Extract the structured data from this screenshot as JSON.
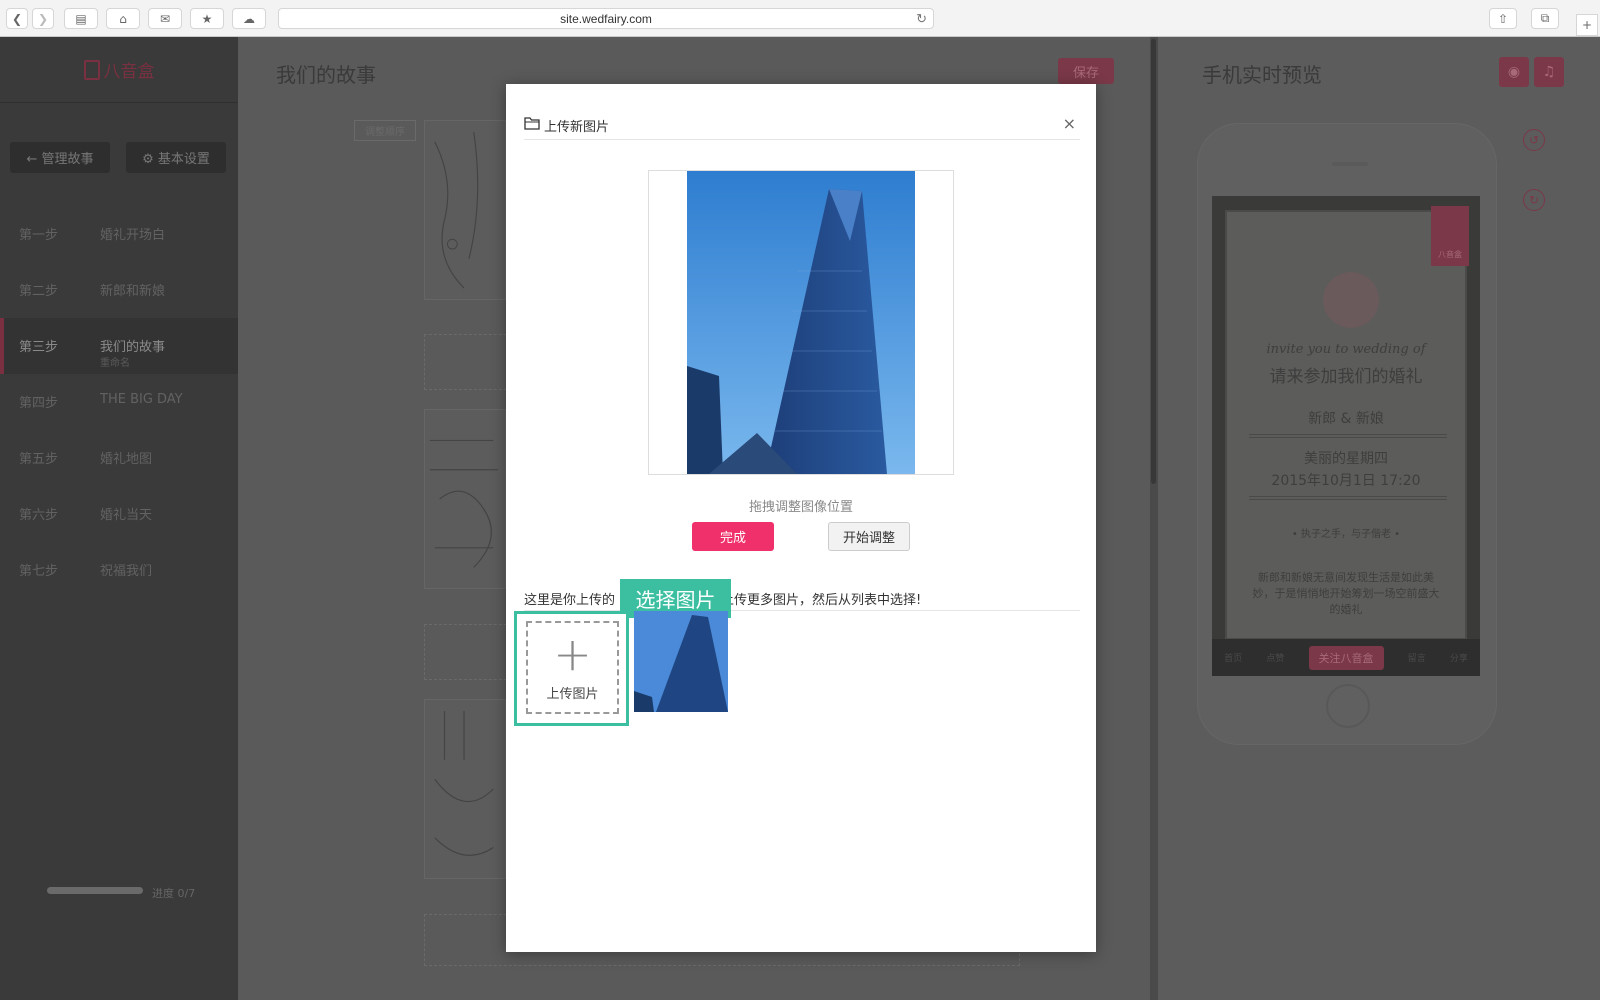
{
  "browser": {
    "url": "site.wedfairy.com"
  },
  "sidebar": {
    "brand": "八音盒",
    "manage_btn": "← 管理故事",
    "settings_btn": "⚙ 基本设置",
    "steps": [
      {
        "num": "第一步",
        "title": "婚礼开场白"
      },
      {
        "num": "第二步",
        "title": "新郎和新娘"
      },
      {
        "num": "第三步",
        "title": "我们的故事",
        "sub": "重命名"
      },
      {
        "num": "第四步",
        "title": "THE BIG DAY"
      },
      {
        "num": "第五步",
        "title": "婚礼地图"
      },
      {
        "num": "第六步",
        "title": "婚礼当天"
      },
      {
        "num": "第七步",
        "title": "祝福我们"
      }
    ],
    "progress_label": "进度 0/7"
  },
  "editor": {
    "title": "我们的故事",
    "save_label": "保存",
    "reorder_label": "调整顺序",
    "add_label": "+"
  },
  "preview": {
    "title": "手机实时预览",
    "card": {
      "brand": "八音盒",
      "script_en": "invite you to wedding of",
      "script_cn": "请来参加我们的婚礼",
      "couple": "新郎 & 新娘",
      "day": "美丽的星期四",
      "datetime": "2015年10月1日 17:20",
      "quote": "• 执子之手，与子偕老 •",
      "body": "新郎和新娘无意间发现生活是如此美妙，于是悄悄地开始筹划一场空前盛大的婚礼"
    },
    "tabbar": {
      "home": "首页",
      "like": "点赞",
      "follow": "关注八音盒",
      "comment": "留言",
      "share": "分享"
    }
  },
  "modal": {
    "title": "上传新图片",
    "close": "×",
    "hint": "拖拽调整图像位置",
    "done_label": "完成",
    "adjust_label": "开始调整",
    "list_text_a": "这里是你上传的",
    "list_text_b": "上传更多图片，然后从列表中选择!",
    "tooltip": "选择图片",
    "upload_label": "上传图片",
    "upload_plus": "+"
  },
  "colors": {
    "accent": "#f0306a",
    "teal": "#3bbfa0",
    "overlay": "#555555"
  },
  "icons": [
    "back-icon",
    "forward-icon",
    "sidebar-icon",
    "home-icon",
    "mail-icon",
    "bookmark-icon",
    "cloud-icon",
    "reload-icon",
    "share-icon",
    "tabs-icon",
    "folder-icon",
    "close-icon",
    "plus-icon",
    "palette-icon",
    "music-icon"
  ]
}
